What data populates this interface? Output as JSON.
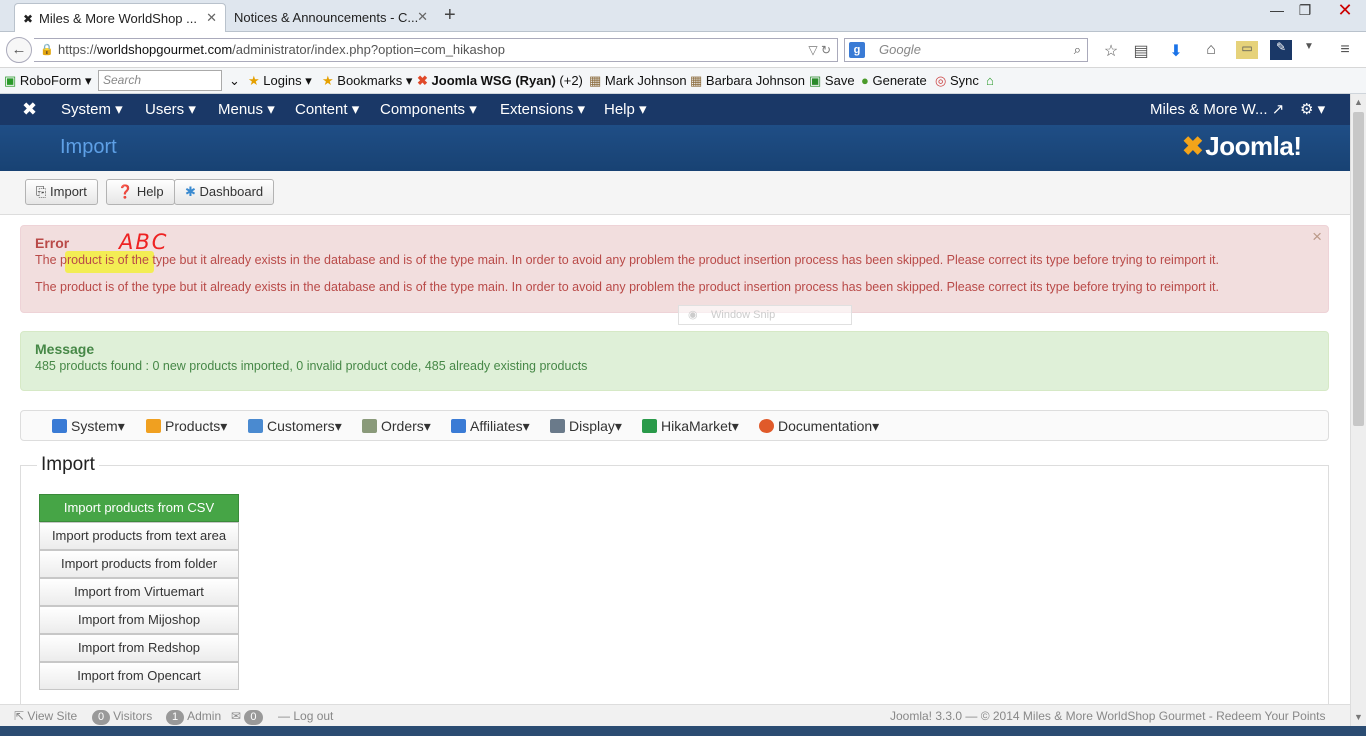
{
  "browser": {
    "tabs": [
      {
        "title": "Miles & More WorldShop ...",
        "active": true
      },
      {
        "title": "Notices & Announcements - C...",
        "active": false
      }
    ],
    "url_prefix": "https://",
    "url_host": "worldshopgourmet.com",
    "url_path": "/administrator/index.php?option=com_hikashop",
    "search_placeholder": "Google",
    "bookmarks": {
      "roboform": "RoboForm",
      "search_placeholder": "Search",
      "logins": "Logins",
      "bookmarks": "Bookmarks",
      "joomla": "Joomla WSG (Ryan)",
      "joomla_extra": "(+2)",
      "mark": "Mark Johnson",
      "barbara": "Barbara Johnson",
      "save": "Save",
      "generate": "Generate",
      "sync": "Sync"
    }
  },
  "admin_nav": {
    "items": [
      "System",
      "Users",
      "Menus",
      "Content",
      "Components",
      "Extensions",
      "Help"
    ],
    "site_link": "Miles & More W..."
  },
  "header": {
    "title": "Import",
    "brand": "Joomla!"
  },
  "toolbar": {
    "import": "Import",
    "help": "Help",
    "dashboard": "Dashboard"
  },
  "error_alert": {
    "heading": "Error",
    "annotation": "ABC",
    "messages": [
      "The product is of the type but it already exists in the database and is of the type main. In order to avoid any problem the product insertion process has been skipped. Please correct its type before trying to reimport it.",
      "The product is of the type but it already exists in the database and is of the type main. In order to avoid any problem the product insertion process has been skipped. Please correct its type before trying to reimport it."
    ]
  },
  "snip_overlay": "Window Snip",
  "success_alert": {
    "heading": "Message",
    "message": "485 products found : 0 new products imported, 0 invalid product code, 485 already existing products"
  },
  "hika_menu": [
    {
      "label": "System",
      "color": "#3a7bd5"
    },
    {
      "label": "Products",
      "color": "#f0a020"
    },
    {
      "label": "Customers",
      "color": "#4a8ad0"
    },
    {
      "label": "Orders",
      "color": "#8a9a7a"
    },
    {
      "label": "Affiliates",
      "color": "#3a7bd5"
    },
    {
      "label": "Display",
      "color": "#6a7a8a"
    },
    {
      "label": "HikaMarket",
      "color": "#2a9a4a"
    },
    {
      "label": "Documentation",
      "color": "#e05a2a"
    }
  ],
  "import_section": {
    "legend": "Import",
    "options": [
      "Import products from CSV",
      "Import products from text area",
      "Import products from folder",
      "Import from Virtuemart",
      "Import from Mijoshop",
      "Import from Redshop",
      "Import from Opencart"
    ]
  },
  "status": {
    "view_site": "View Site",
    "visitors_count": "0",
    "visitors": "Visitors",
    "admin_count": "1",
    "admin": "Admin",
    "messages_count": "0",
    "logout": "Log out",
    "footer": "Joomla! 3.3.0  —  © 2014 Miles & More WorldShop Gourmet - Redeem Your Points"
  }
}
